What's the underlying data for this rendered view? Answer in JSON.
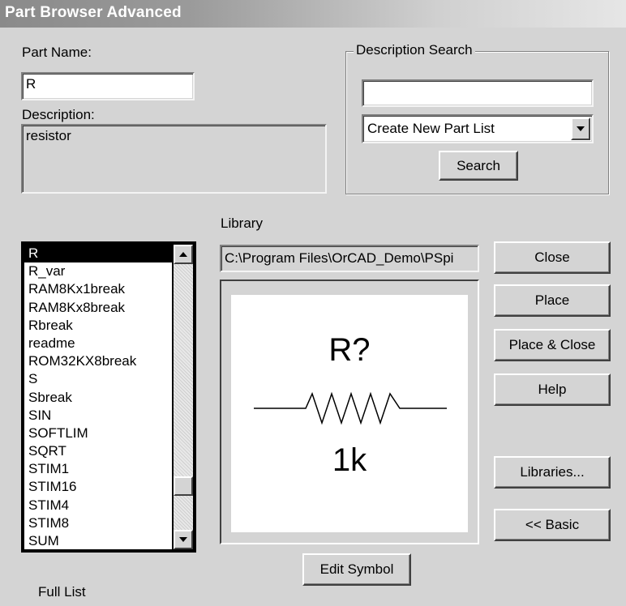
{
  "window": {
    "title": "Part Browser Advanced"
  },
  "part_name": {
    "label": "Part Name:",
    "value": "R"
  },
  "description": {
    "label": "Description:",
    "value": "resistor"
  },
  "description_search": {
    "title": "Description Search",
    "query": "",
    "dropdown_selected": "Create New Part List",
    "search_button": "Search"
  },
  "library": {
    "label": "Library",
    "path": "C:\\Program Files\\OrCAD_Demo\\PSpi"
  },
  "part_list": {
    "items": [
      "R",
      "R_var",
      "RAM8Kx1break",
      "RAM8Kx8break",
      "Rbreak",
      "readme",
      "ROM32KX8break",
      "S",
      "Sbreak",
      "SIN",
      "SOFTLIM",
      "SQRT",
      "STIM1",
      "STIM16",
      "STIM4",
      "STIM8",
      "SUM"
    ],
    "selected_index": 0
  },
  "preview": {
    "refdes": "R?",
    "value": "1k"
  },
  "buttons": {
    "close": "Close",
    "place": "Place",
    "place_close": "Place & Close",
    "help": "Help",
    "libraries": "Libraries...",
    "basic": "<< Basic",
    "edit_symbol": "Edit Symbol"
  },
  "footer": {
    "full_list": "Full List"
  },
  "icons": {
    "scroll_up": "up-arrow-icon",
    "scroll_down": "down-arrow-icon",
    "dropdown": "dropdown-arrow-icon"
  }
}
